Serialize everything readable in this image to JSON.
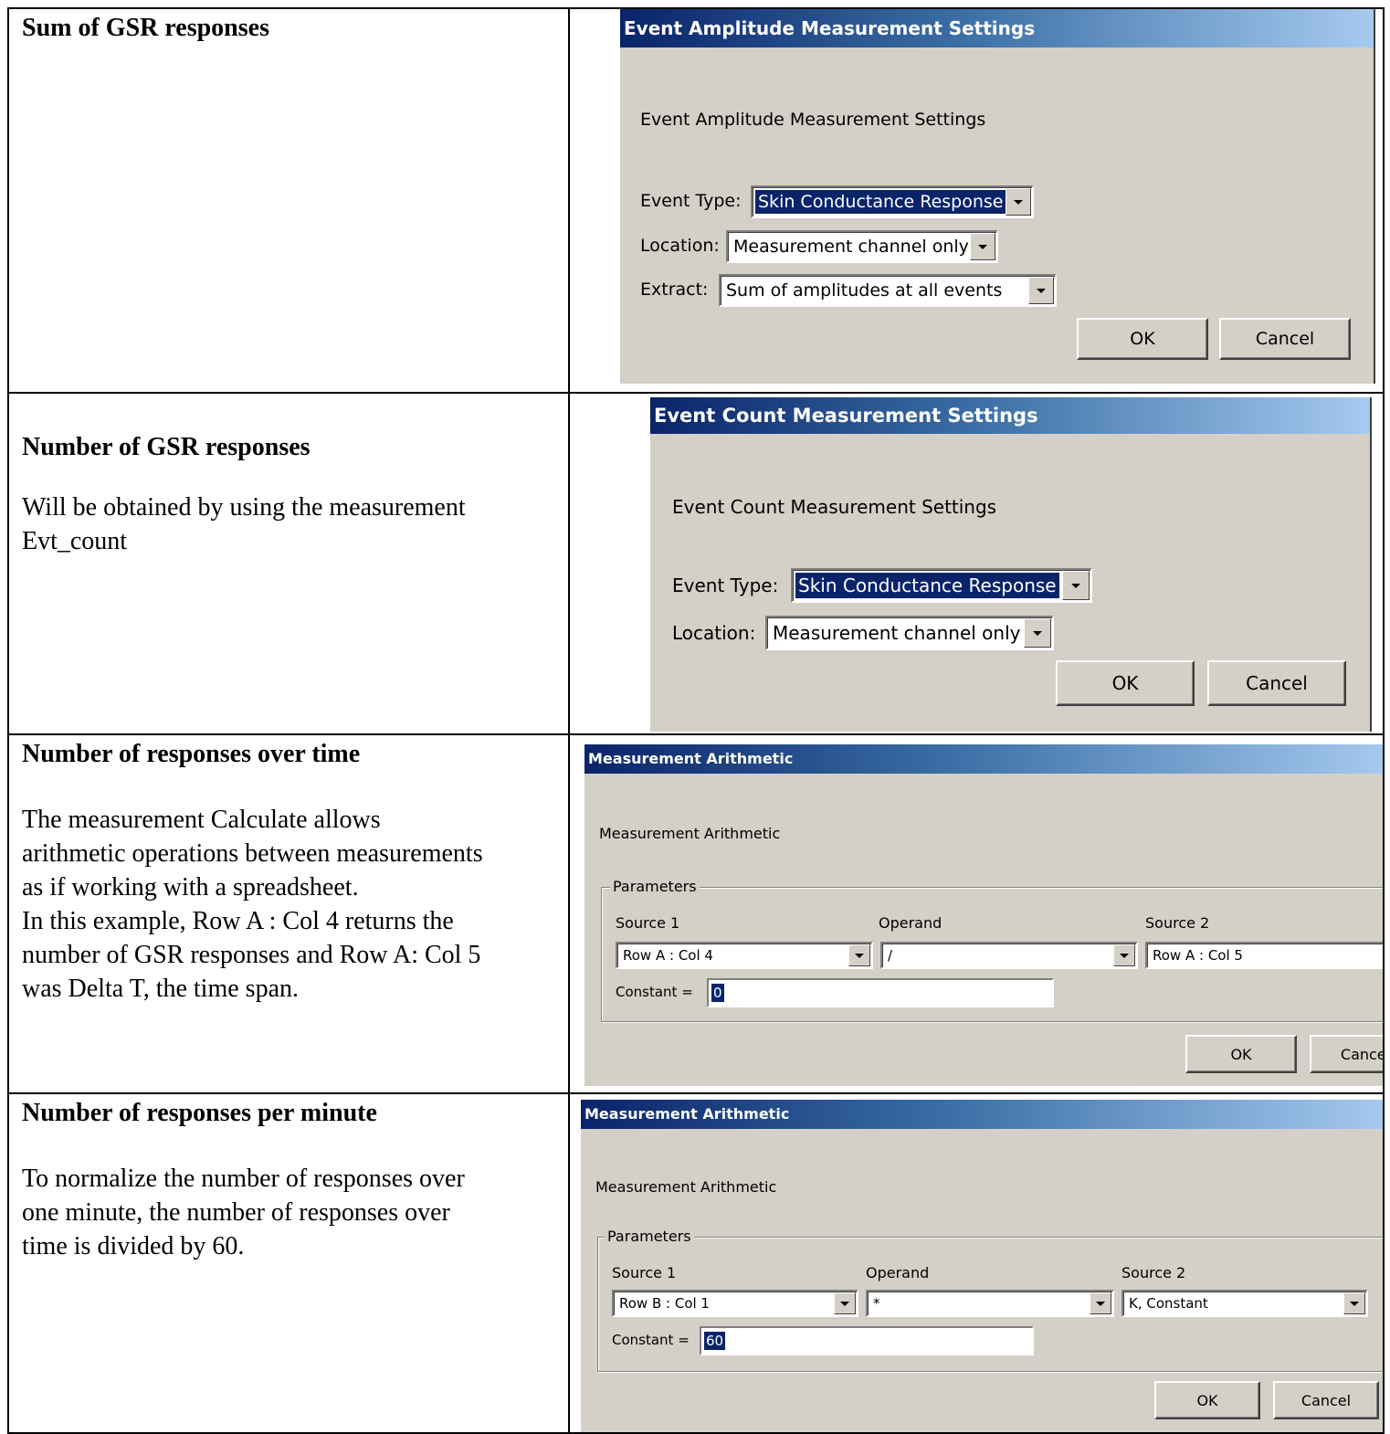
{
  "rows": [
    {
      "title": "Sum of GSR responses",
      "description": [],
      "dialog": {
        "title": "Event Amplitude Measurement Settings",
        "heading": "Event Amplitude Measurement Settings",
        "event_type_label": "Event Type:",
        "event_type_value": "Skin Conductance Response",
        "location_label": "Location:",
        "location_value": "Measurement channel only",
        "extract_label": "Extract:",
        "extract_value": "Sum of amplitudes at all events",
        "ok_label": "OK",
        "cancel_label": "Cancel"
      }
    },
    {
      "title": "Number of GSR responses",
      "description": [
        "Will be obtained by using the measurement",
        "Evt_count"
      ],
      "dialog": {
        "title": "Event Count Measurement Settings",
        "heading": "Event Count Measurement Settings",
        "event_type_label": "Event Type:",
        "event_type_value": "Skin Conductance Response",
        "location_label": "Location:",
        "location_value": "Measurement channel only",
        "ok_label": "OK",
        "cancel_label": "Cancel"
      }
    },
    {
      "title": "Number of responses over time",
      "description": [
        "The measurement Calculate allows",
        "arithmetic operations between measurements",
        "as if working with a spreadsheet.",
        "In this example, Row A : Col 4 returns the",
        "number of GSR responses and Row A: Col 5",
        "was Delta T, the time span."
      ],
      "dialog": {
        "title": "Measurement Arithmetic",
        "heading": "Measurement Arithmetic",
        "group_label": "Parameters",
        "source1_label": "Source 1",
        "operand_label": "Operand",
        "source2_label": "Source 2",
        "source1_value": "Row A : Col 4",
        "operand_value": "/",
        "source2_value": "Row A : Col 5",
        "constant_label": "Constant =",
        "constant_value": "0",
        "ok_label": "OK",
        "cancel_label": "Cancel"
      }
    },
    {
      "title": "Number of responses per minute",
      "description": [
        "To normalize the number of responses over",
        "one minute, the number of responses over",
        "time is divided by 60."
      ],
      "dialog": {
        "title": "Measurement Arithmetic",
        "heading": "Measurement Arithmetic",
        "group_label": "Parameters",
        "source1_label": "Source 1",
        "operand_label": "Operand",
        "source2_label": "Source 2",
        "source1_value": "Row B : Col 1",
        "operand_value": "*",
        "source2_value": "K, Constant",
        "constant_label": "Constant =",
        "constant_value": "60",
        "ok_label": "OK",
        "cancel_label": "Cancel"
      }
    }
  ],
  "colors": {
    "dialog_face": "#d4d0c8",
    "titlebar_start": "#0a246a",
    "titlebar_end": "#a6caf0",
    "selection": "#0a246a"
  }
}
